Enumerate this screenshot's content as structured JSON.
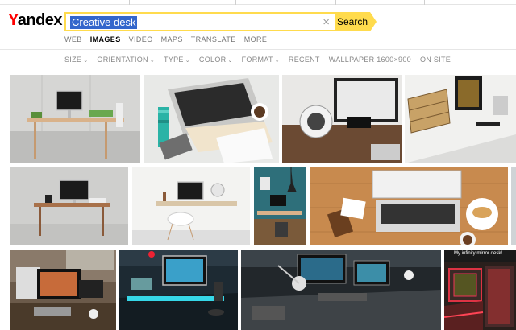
{
  "logo": {
    "first": "Y",
    "rest": "andex"
  },
  "search": {
    "query": "Creative desk",
    "clear_icon": "×",
    "button_label": "Search"
  },
  "services": [
    {
      "label": "WEB",
      "active": false
    },
    {
      "label": "IMAGES",
      "active": true
    },
    {
      "label": "VIDEO",
      "active": false
    },
    {
      "label": "MAPS",
      "active": false
    },
    {
      "label": "TRANSLATE",
      "active": false
    },
    {
      "label": "MORE",
      "active": false
    }
  ],
  "filters": [
    {
      "label": "SIZE",
      "dropdown": true
    },
    {
      "label": "ORIENTATION",
      "dropdown": true
    },
    {
      "label": "TYPE",
      "dropdown": true
    },
    {
      "label": "COLOR",
      "dropdown": true
    },
    {
      "label": "FORMAT",
      "dropdown": true
    },
    {
      "label": "RECENT",
      "dropdown": false
    },
    {
      "label": "WALLPAPER 1600×900",
      "dropdown": false
    },
    {
      "label": "ON SITE",
      "dropdown": false
    }
  ],
  "thumb_caption": "My infinity mirror desk!",
  "colors": {
    "accent": "#ffdb4d",
    "selection": "#3366cc",
    "logo_red": "#ff0000"
  }
}
